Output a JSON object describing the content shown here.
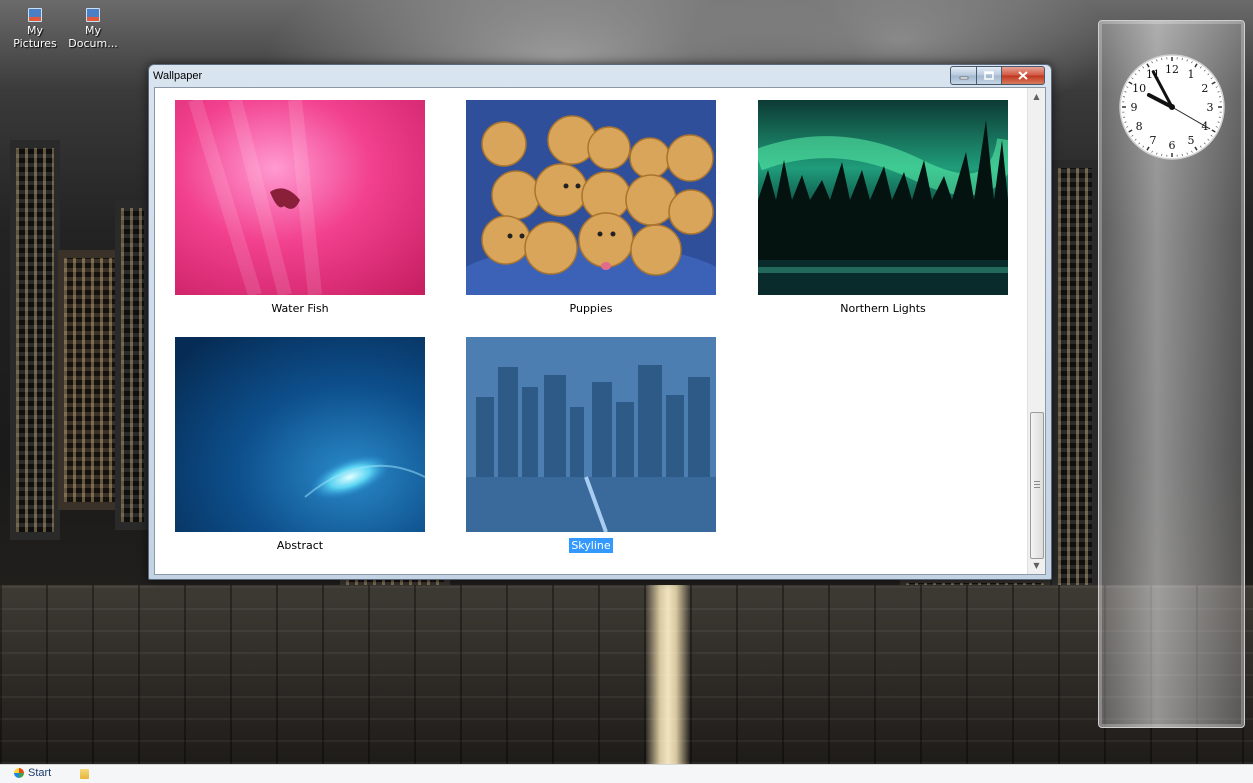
{
  "desktop": {
    "icons": [
      {
        "label": "My\nPictures",
        "icon": "my-pictures-icon"
      },
      {
        "label": "My\nDocum...",
        "icon": "my-documents-icon"
      }
    ]
  },
  "window": {
    "title": "Wallpaper",
    "buttons": {
      "minimize": "minimize-icon",
      "maximize": "maximize-icon",
      "close": "close-icon"
    },
    "wallpapers": [
      {
        "label": "Water Fish",
        "selected": false
      },
      {
        "label": "Puppies",
        "selected": false
      },
      {
        "label": "Northern Lights",
        "selected": false
      },
      {
        "label": "Abstract",
        "selected": false
      },
      {
        "label": "Skyline",
        "selected": true
      }
    ]
  },
  "clock": {
    "numerals": [
      "12",
      "1",
      "2",
      "3",
      "4",
      "5",
      "6",
      "7",
      "8",
      "9",
      "10",
      "11"
    ],
    "time": "9:55:20"
  },
  "taskbar": {
    "start_label": "Start"
  }
}
